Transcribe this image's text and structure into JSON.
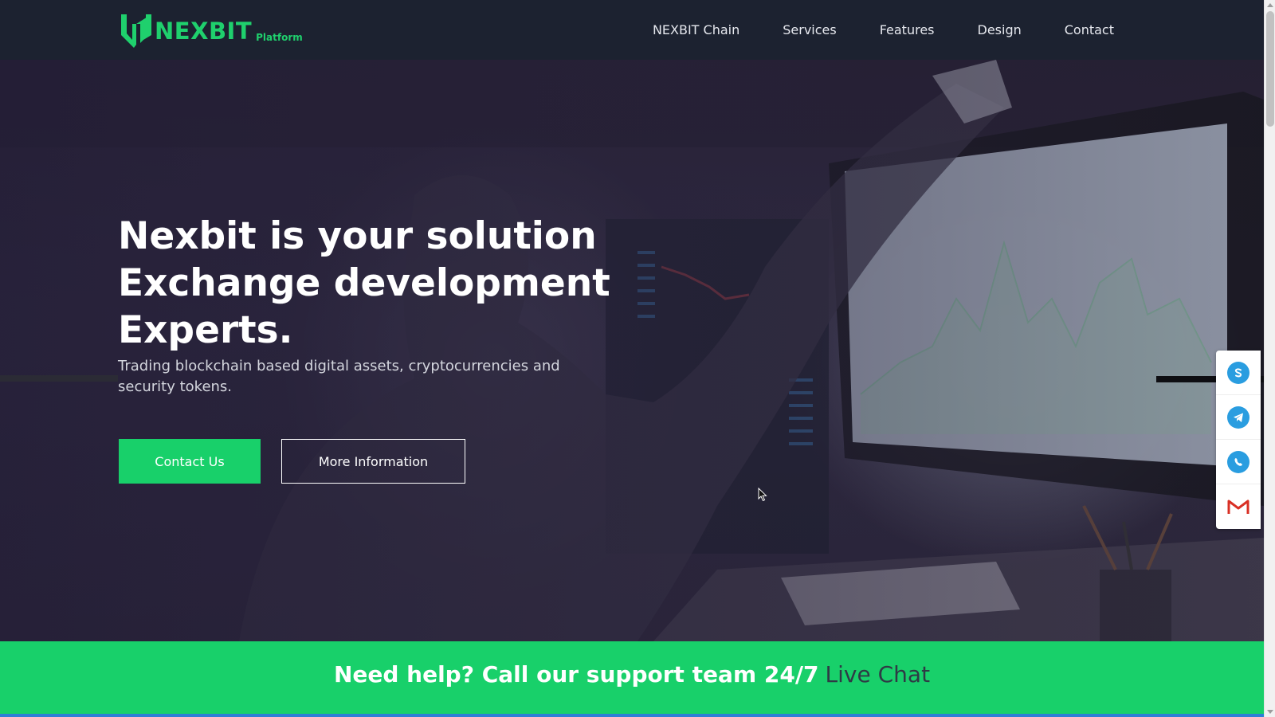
{
  "header": {
    "logo_text": "NEXBIT",
    "logo_sub": "Platform",
    "nav": [
      {
        "label": "NEXBIT Chain"
      },
      {
        "label": "Services"
      },
      {
        "label": "Features"
      },
      {
        "label": "Design"
      },
      {
        "label": "Contact"
      }
    ]
  },
  "hero": {
    "title_lines": [
      "Nexbit is your solution",
      "Exchange development",
      "Experts."
    ],
    "subtitle": "Trading blockchain based digital assets, cryptocurrencies and security tokens.",
    "primary_button": "Contact Us",
    "secondary_button": "More Information"
  },
  "social": [
    {
      "icon": "skype-icon"
    },
    {
      "icon": "telegram-icon"
    },
    {
      "icon": "whatsapp-icon"
    },
    {
      "icon": "gmail-icon"
    }
  ],
  "help_banner": {
    "text": "Need help? Call our support team 24/7",
    "link": "Live Chat"
  },
  "colors": {
    "brand_green": "#18d06a",
    "header_bg": "#1c2230",
    "telegram_blue": "#2a9de0",
    "gmail_red": "#d93025"
  }
}
